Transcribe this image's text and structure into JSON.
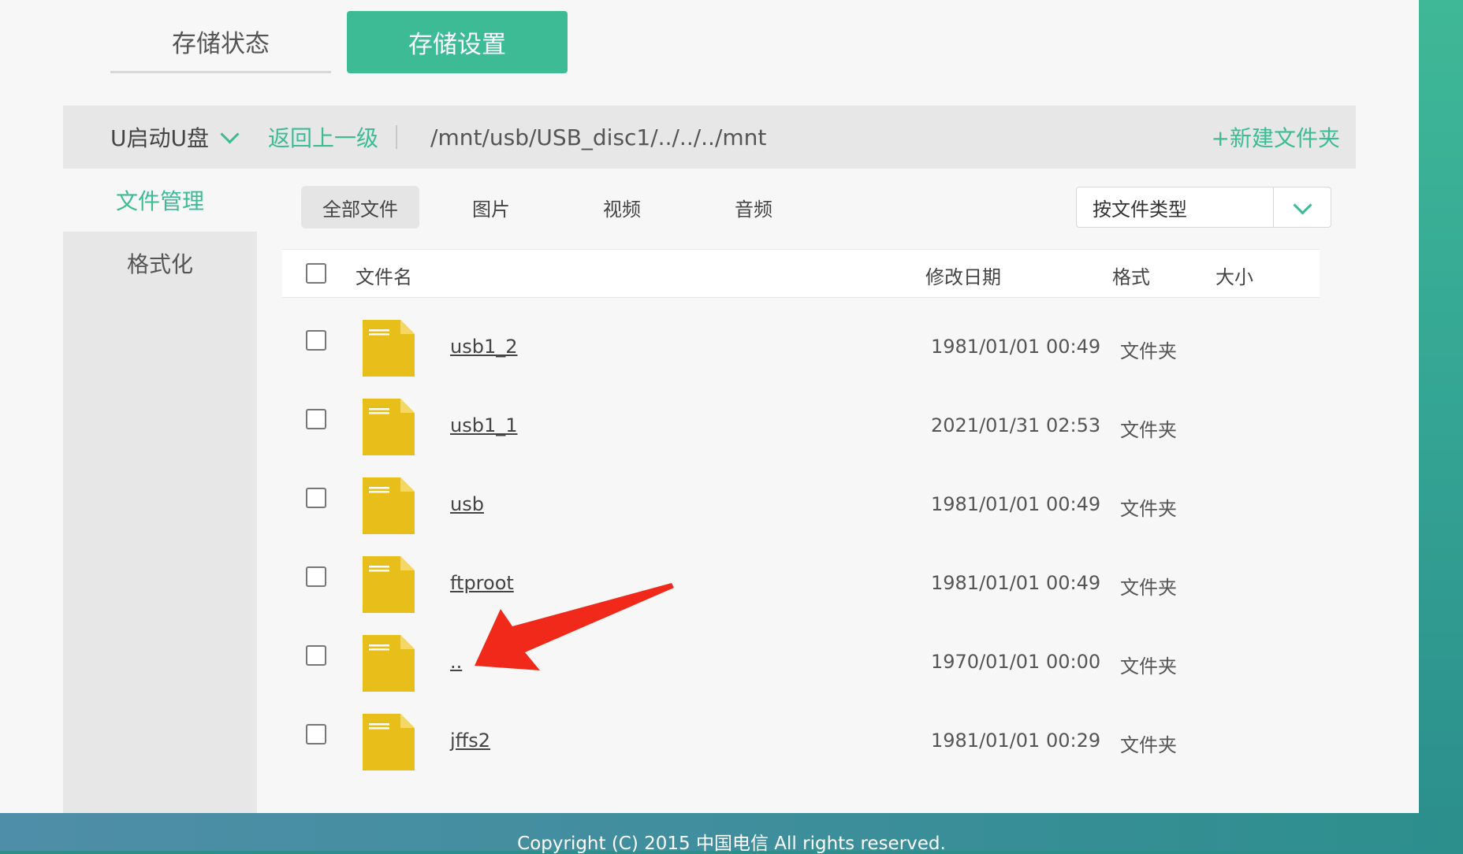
{
  "tabs": {
    "status": "存储状态",
    "settings": "存储设置"
  },
  "path_bar": {
    "disk": "U启动U盘",
    "back": "返回上一级",
    "path": "/mnt/usb/USB_disc1/../../../mnt",
    "new_folder": "+新建文件夹"
  },
  "menu": {
    "file_manage": "文件管理",
    "format": "格式化"
  },
  "filters": {
    "all": "全部文件",
    "images": "图片",
    "video": "视频",
    "audio": "音频",
    "type_select": "按文件类型"
  },
  "table": {
    "headers": {
      "name": "文件名",
      "date": "修改日期",
      "format": "格式",
      "size": "大小"
    },
    "rows": [
      {
        "name": "usb1_2",
        "date": "1981/01/01 00:49",
        "format": "文件夹"
      },
      {
        "name": "usb1_1",
        "date": "2021/01/31 02:53",
        "format": "文件夹"
      },
      {
        "name": "usb",
        "date": "1981/01/01 00:49",
        "format": "文件夹"
      },
      {
        "name": "ftproot",
        "date": "1981/01/01 00:49",
        "format": "文件夹"
      },
      {
        "name": "..",
        "date": "1970/01/01 00:00",
        "format": "文件夹"
      },
      {
        "name": "jffs2",
        "date": "1981/01/01 00:29",
        "format": "文件夹"
      }
    ]
  },
  "footer": "Copyright (C) 2015 中国电信 All rights reserved.",
  "colors": {
    "accent": "#3cbb94",
    "folder": "#e8bf1a",
    "annotation_arrow": "#f0291a"
  },
  "icons": {
    "folder": "folder-icon",
    "dropdown": "chevron-down-icon",
    "annotation": "red-arrow-annotation"
  }
}
